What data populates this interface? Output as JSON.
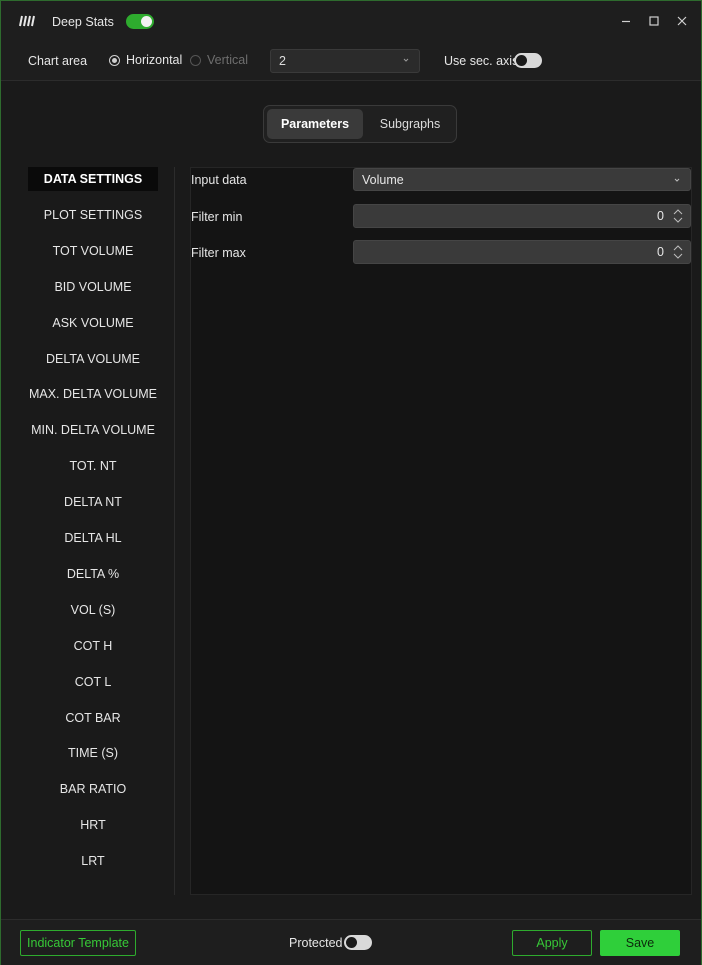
{
  "window": {
    "title": "Deep Stats",
    "enabled": true
  },
  "toolbar": {
    "chart_area_label": "Chart area",
    "orientation_options": [
      "Horizontal",
      "Vertical"
    ],
    "orientation_selected": "Horizontal",
    "chart_index_value": "2",
    "sec_axis_label": "Use sec. axis",
    "sec_axis_enabled": false
  },
  "tabs": [
    {
      "label": "Parameters",
      "active": true
    },
    {
      "label": "Subgraphs",
      "active": false
    }
  ],
  "sidebar": {
    "items": [
      "DATA SETTINGS",
      "PLOT SETTINGS",
      "TOT VOLUME",
      "BID VOLUME",
      "ASK VOLUME",
      "DELTA VOLUME",
      "MAX. DELTA VOLUME",
      "MIN. DELTA VOLUME",
      "TOT. NT",
      "DELTA NT",
      "DELTA HL",
      "DELTA %",
      "VOL (S)",
      "COT H",
      "COT L",
      "COT BAR",
      "TIME (S)",
      "BAR RATIO",
      "HRT",
      "LRT"
    ],
    "active_index": 0
  },
  "params": {
    "input_data": {
      "label": "Input data",
      "value": "Volume"
    },
    "filter_min": {
      "label": "Filter min",
      "value": "0"
    },
    "filter_max": {
      "label": "Filter max",
      "value": "0"
    }
  },
  "footer": {
    "template_label": "Indicator Template",
    "protected_label": "Protected",
    "protected_enabled": false,
    "apply_label": "Apply",
    "save_label": "Save"
  },
  "colors": {
    "accent_green": "#2eab2e",
    "save_green": "#2fcf3a",
    "background": "#1a1a1a"
  }
}
